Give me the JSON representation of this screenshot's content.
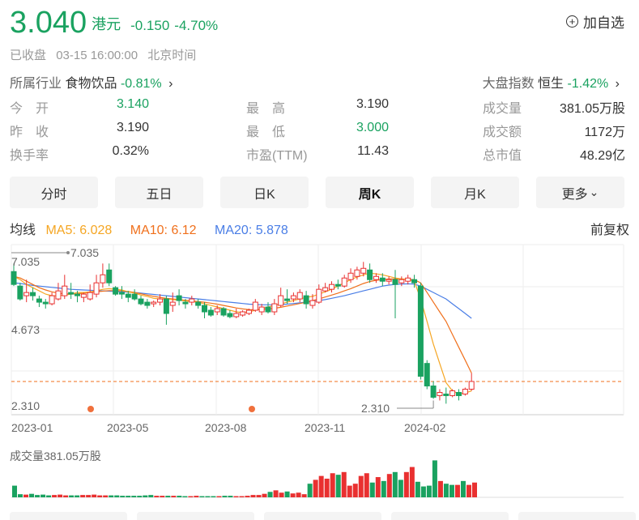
{
  "quote": {
    "price": "3.040",
    "currency": "港元",
    "change": "-0.150",
    "change_pct": "-4.70%",
    "favorite_label": "加自选"
  },
  "status": {
    "state": "已收盘",
    "time": "03-15 16:00:00",
    "tz": "北京时间"
  },
  "industry": {
    "label": "所属行业",
    "name": "食物饮品",
    "change": "-0.81%"
  },
  "market_index": {
    "label": "大盘指数",
    "name": "恒生",
    "change": "-1.42%"
  },
  "stats": [
    [
      {
        "label": "今　开",
        "value": "3.140",
        "color": "#1aa260"
      },
      {
        "label": "最　高",
        "value": "3.190",
        "color": "#333333"
      },
      {
        "label": "成交量",
        "value": "381.05万股",
        "color": "#333333"
      }
    ],
    [
      {
        "label": "昨　收",
        "value": "3.190",
        "color": "#333333"
      },
      {
        "label": "最　低",
        "value": "3.000",
        "color": "#1aa260"
      },
      {
        "label": "成交额",
        "value": "1172万",
        "color": "#333333"
      }
    ],
    [
      {
        "label": "换手率",
        "value": "0.32%",
        "color": "#333333"
      },
      {
        "label": "市盈(TTM)",
        "value": "11.43",
        "color": "#333333"
      },
      {
        "label": "总市值",
        "value": "48.29亿",
        "color": "#333333"
      }
    ]
  ],
  "tabs": [
    "分时",
    "五日",
    "日K",
    "周K",
    "月K",
    "更多"
  ],
  "active_tab": "周K",
  "ma": {
    "label": "均线",
    "ma5": "MA5: 6.028",
    "ma10": "MA10: 6.12",
    "ma20": "MA20: 5.878",
    "adjust": "前复权"
  },
  "chart_data": {
    "type": "candlestick",
    "y_labels": [
      "7.035",
      "4.673",
      "2.310"
    ],
    "max_label": "7.035",
    "min_label": "2.310",
    "x_labels": [
      "2023-01",
      "2023-05",
      "2023-08",
      "2023-11",
      "2024-02"
    ],
    "last_price": 3.04,
    "ylim": [
      2.31,
      7.035
    ],
    "candles": [
      [
        6.45,
        6.7,
        6.05,
        6.0
      ],
      [
        6.0,
        6.1,
        5.6,
        5.55
      ],
      [
        5.7,
        6.2,
        5.8,
        5.5
      ],
      [
        5.8,
        5.95,
        5.7,
        5.55
      ],
      [
        5.6,
        5.7,
        5.5,
        5.35
      ],
      [
        5.5,
        5.6,
        5.45,
        5.3
      ],
      [
        5.45,
        5.8,
        5.7,
        5.4
      ],
      [
        5.6,
        6.1,
        5.85,
        5.55
      ],
      [
        5.7,
        6.35,
        6.0,
        5.6
      ],
      [
        5.8,
        6.1,
        5.75,
        5.6
      ],
      [
        5.75,
        5.85,
        5.7,
        5.5
      ],
      [
        5.65,
        5.8,
        5.75,
        5.5
      ],
      [
        5.6,
        6.05,
        5.8,
        5.55
      ],
      [
        5.75,
        6.35,
        6.1,
        5.65
      ],
      [
        6.1,
        6.7,
        6.35,
        5.95
      ],
      [
        6.5,
        6.7,
        6.1,
        6.0
      ],
      [
        5.95,
        6.0,
        5.75,
        5.7
      ],
      [
        5.8,
        6.0,
        5.75,
        5.6
      ],
      [
        5.75,
        5.85,
        5.65,
        5.5
      ],
      [
        5.75,
        5.9,
        5.6,
        5.55
      ],
      [
        5.6,
        5.7,
        5.45,
        5.4
      ],
      [
        5.5,
        5.6,
        5.4,
        5.3
      ],
      [
        5.45,
        5.55,
        5.5,
        5.35
      ],
      [
        5.5,
        5.75,
        5.6,
        5.4
      ],
      [
        5.6,
        5.7,
        5.15,
        4.8
      ],
      [
        5.4,
        5.8,
        5.5,
        5.2
      ],
      [
        5.7,
        5.9,
        5.55,
        5.4
      ],
      [
        5.5,
        5.6,
        5.45,
        5.3
      ],
      [
        5.5,
        5.7,
        5.6,
        5.4
      ],
      [
        5.5,
        5.6,
        5.4,
        5.3
      ],
      [
        5.4,
        5.5,
        5.2,
        5.0
      ],
      [
        5.25,
        5.35,
        5.1,
        5.05
      ],
      [
        5.2,
        5.4,
        5.3,
        5.1
      ],
      [
        5.3,
        5.35,
        5.1,
        5.05
      ],
      [
        5.15,
        5.25,
        5.05,
        5.0
      ],
      [
        5.05,
        5.3,
        5.15,
        5.0
      ],
      [
        5.1,
        5.25,
        5.2,
        5.05
      ],
      [
        5.15,
        5.3,
        5.25,
        5.1
      ],
      [
        5.25,
        5.6,
        5.5,
        5.2
      ],
      [
        5.2,
        5.45,
        5.35,
        5.1
      ],
      [
        5.35,
        5.5,
        5.2,
        5.15
      ],
      [
        5.2,
        5.6,
        5.45,
        5.1
      ],
      [
        5.4,
        5.95,
        5.7,
        5.35
      ],
      [
        5.6,
        5.9,
        5.55,
        5.45
      ],
      [
        5.6,
        5.8,
        5.7,
        5.5
      ],
      [
        5.6,
        5.9,
        5.8,
        5.5
      ],
      [
        5.7,
        5.85,
        5.45,
        5.3
      ],
      [
        5.4,
        5.75,
        5.55,
        5.3
      ],
      [
        5.5,
        6.05,
        5.9,
        5.45
      ],
      [
        5.85,
        6.1,
        5.95,
        5.8
      ],
      [
        5.9,
        6.15,
        6.05,
        5.8
      ],
      [
        6.05,
        6.2,
        6.0,
        5.9
      ],
      [
        6.0,
        6.35,
        6.25,
        5.95
      ],
      [
        6.2,
        6.55,
        6.4,
        6.1
      ],
      [
        6.3,
        6.6,
        6.5,
        6.2
      ],
      [
        6.4,
        6.75,
        6.55,
        6.3
      ],
      [
        6.5,
        6.7,
        6.2,
        6.1
      ],
      [
        6.2,
        6.4,
        6.3,
        6.1
      ],
      [
        6.25,
        6.4,
        6.15,
        6.0
      ],
      [
        6.15,
        6.3,
        6.2,
        6.05
      ],
      [
        6.2,
        6.5,
        6.05,
        5.0
      ],
      [
        6.1,
        6.3,
        6.2,
        6.0
      ],
      [
        6.15,
        6.35,
        6.25,
        6.05
      ],
      [
        6.2,
        6.35,
        6.1,
        5.95
      ],
      [
        6.0,
        6.1,
        3.2,
        3.1
      ],
      [
        3.6,
        3.7,
        2.9,
        2.8
      ],
      [
        2.9,
        3.05,
        2.55,
        2.5
      ],
      [
        2.6,
        2.8,
        2.7,
        2.45
      ],
      [
        2.65,
        2.85,
        2.6,
        2.35
      ],
      [
        2.6,
        2.8,
        2.75,
        2.55
      ],
      [
        2.7,
        2.8,
        2.6,
        2.45
      ],
      [
        2.65,
        2.85,
        2.8,
        2.6
      ],
      [
        2.8,
        3.3,
        3.04,
        2.75
      ]
    ],
    "ma5": [
      6.3,
      6.2,
      6.05,
      5.95,
      5.85,
      5.75,
      5.7,
      5.7,
      5.72,
      5.75,
      5.8,
      5.8,
      5.82,
      5.85,
      5.9,
      5.92,
      5.9,
      5.88,
      5.82,
      5.78,
      5.72,
      5.68,
      5.62,
      5.6,
      5.6,
      5.58,
      5.56,
      5.54,
      5.52,
      5.5,
      5.45,
      5.4,
      5.35,
      5.3,
      5.25,
      5.2,
      5.18,
      5.2,
      5.25,
      5.3,
      5.35,
      5.4,
      5.45,
      5.5,
      5.55,
      5.6,
      5.65,
      5.68,
      5.75,
      5.82,
      5.9,
      6.0,
      6.1,
      6.2,
      6.28,
      6.35,
      6.4,
      6.38,
      6.35,
      6.3,
      6.25,
      6.22,
      6.2,
      6.15,
      5.6,
      4.9,
      4.2,
      3.6,
      3.0,
      2.75,
      2.65,
      2.68,
      2.75
    ],
    "ma10": [
      6.3,
      6.25,
      6.15,
      6.05,
      5.95,
      5.88,
      5.82,
      5.78,
      5.76,
      5.75,
      5.76,
      5.78,
      5.8,
      5.82,
      5.84,
      5.86,
      5.86,
      5.85,
      5.83,
      5.8,
      5.76,
      5.72,
      5.68,
      5.65,
      5.62,
      5.6,
      5.58,
      5.56,
      5.54,
      5.52,
      5.5,
      5.47,
      5.44,
      5.4,
      5.36,
      5.32,
      5.29,
      5.27,
      5.26,
      5.27,
      5.29,
      5.31,
      5.34,
      5.38,
      5.42,
      5.46,
      5.5,
      5.55,
      5.6,
      5.66,
      5.72,
      5.78,
      5.85,
      5.92,
      6.0,
      6.08,
      6.14,
      6.18,
      6.2,
      6.22,
      6.22,
      6.22,
      6.21,
      6.2,
      6.1,
      5.8,
      5.5,
      5.2,
      4.9,
      4.5,
      4.1,
      3.7,
      3.3
    ],
    "ma20": [
      6.1,
      6.08,
      6.05,
      6.02,
      6.0,
      5.98,
      5.96,
      5.94,
      5.92,
      5.9,
      5.89,
      5.88,
      5.87,
      5.86,
      5.85,
      5.84,
      5.83,
      5.82,
      5.81,
      5.8,
      5.78,
      5.76,
      5.74,
      5.72,
      5.7,
      5.68,
      5.66,
      5.64,
      5.62,
      5.6,
      5.58,
      5.56,
      5.54,
      5.52,
      5.5,
      5.48,
      5.46,
      5.44,
      5.43,
      5.42,
      5.42,
      5.42,
      5.43,
      5.44,
      5.46,
      5.48,
      5.5,
      5.52,
      5.55,
      5.58,
      5.62,
      5.66,
      5.7,
      5.75,
      5.8,
      5.85,
      5.9,
      5.95,
      6.0,
      6.03,
      6.05,
      6.06,
      6.07,
      6.06,
      6.0,
      5.9,
      5.8,
      5.7,
      5.6,
      5.45,
      5.3,
      5.15,
      5.0
    ],
    "markers": [
      17,
      53
    ],
    "volume_label": "成交量381.05万股",
    "volumes": [
      0.3,
      0.08,
      0.07,
      0.09,
      0.06,
      0.07,
      0.05,
      0.06,
      0.07,
      0.05,
      0.05,
      0.05,
      0.06,
      0.06,
      0.07,
      0.05,
      0.05,
      0.05,
      0.05,
      0.04,
      0.04,
      0.04,
      0.04,
      0.05,
      0.06,
      0.04,
      0.04,
      0.04,
      0.04,
      0.04,
      0.03,
      0.03,
      0.04,
      0.03,
      0.03,
      0.03,
      0.03,
      0.04,
      0.04,
      0.03,
      0.03,
      0.04,
      0.06,
      0.06,
      0.09,
      0.14,
      0.18,
      0.12,
      0.15,
      0.1,
      0.12,
      0.08,
      0.35,
      0.45,
      0.55,
      0.48,
      0.62,
      0.58,
      0.65,
      0.3,
      0.35,
      0.55,
      0.62,
      0.38,
      0.52,
      0.42,
      0.6,
      0.65,
      0.45,
      0.65,
      0.78,
      0.4,
      0.28,
      0.3,
      0.95,
      0.42,
      0.35,
      0.32,
      0.32,
      0.42,
      0.32,
      0.38
    ],
    "volume_colors": "mixed"
  },
  "colors": {
    "up": "#e93030",
    "down": "#1aa260",
    "ma5": "#f5a623",
    "ma10": "#f0701c",
    "ma20": "#4a7ee6",
    "last_line": "#f0701c"
  }
}
